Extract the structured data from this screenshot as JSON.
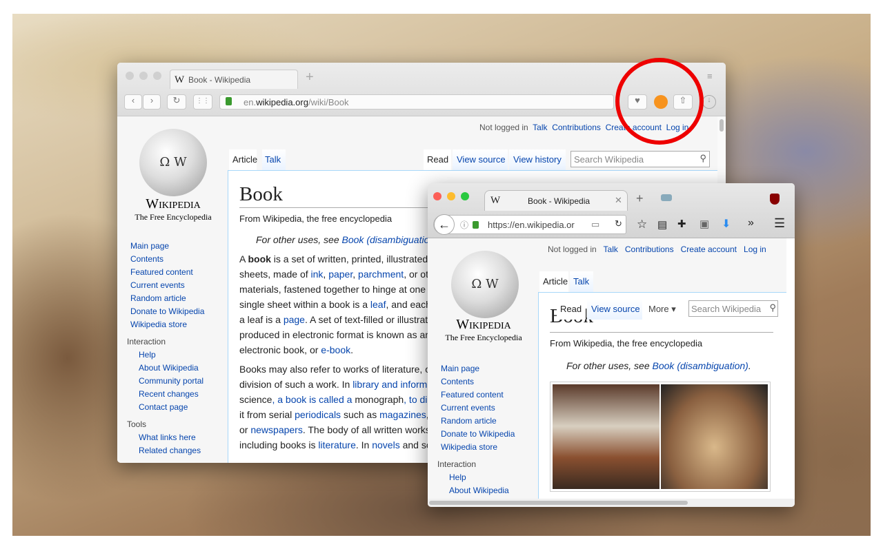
{
  "back": {
    "tab_title": "Book - Wikipedia",
    "url_prefix": "en.",
    "url_domain": "wikipedia.org",
    "url_path": "/wiki/Book",
    "personal": {
      "not_logged": "Not logged in",
      "talk": "Talk",
      "contributions": "Contributions",
      "create": "Create account",
      "login": "Log in"
    },
    "tabs": {
      "article": "Article",
      "talk": "Talk",
      "read": "Read",
      "view_source": "View source",
      "view_history": "View history"
    },
    "search_placeholder": "Search Wikipedia",
    "wordmark": "Wikipedia",
    "tagline": "The Free Encyclopedia",
    "title": "Book",
    "from": "From Wikipedia, the free encyclopedia",
    "hatnote_pre": "For other uses, see ",
    "hatnote_link": "Book (disambiguatio",
    "lines": [
      [
        "A ",
        "<b>book",
        "is a set of written, printed, illustrated"
      ],
      [
        "sheets, made of ",
        "ink",
        ", ",
        "paper",
        ", ",
        "parchment",
        ", or ot"
      ],
      [
        "materials, fastened together to hinge at one"
      ],
      [
        "single sheet within a book is a ",
        "leaf",
        ", and each"
      ],
      [
        "a leaf is a ",
        "page",
        ". A set of text-filled or illustrat"
      ],
      [
        "produced in electronic format is known as an"
      ],
      [
        "electronic book, or ",
        "e-book",
        "."
      ]
    ],
    "lines2": [
      [
        "Books may also refer to works of literature, o"
      ],
      [
        "division of such a work. In ",
        "library and inform"
      ],
      [
        "science",
        ", a book is called a ",
        "monograph",
        ", to di"
      ],
      [
        "it from serial ",
        "periodicals",
        " such as ",
        "magazines",
        ","
      ],
      [
        "or ",
        "newspapers",
        ". The body of all written works"
      ],
      [
        "including books is ",
        "literature",
        ". In ",
        "novels",
        " and so"
      ]
    ],
    "nav": [
      "Main page",
      "Contents",
      "Featured content",
      "Current events",
      "Random article",
      "Donate to Wikipedia",
      "Wikipedia store"
    ],
    "interaction_h": "Interaction",
    "interaction": [
      "Help",
      "About Wikipedia",
      "Community portal",
      "Recent changes",
      "Contact page"
    ],
    "tools_h": "Tools",
    "tools": [
      "What links here",
      "Related changes"
    ]
  },
  "front": {
    "tab_title": "Book - Wikipedia",
    "url": "https://en.wikipedia.or",
    "personal": {
      "not_logged": "Not logged in",
      "talk": "Talk",
      "contributions": "Contributions",
      "create": "Create account",
      "login": "Log in"
    },
    "tabs": {
      "article": "Article",
      "talk": "Talk",
      "read": "Read",
      "view_source": "View source",
      "more": "More"
    },
    "search_placeholder": "Search Wikipedia",
    "wordmark": "Wikipedia",
    "tagline": "The Free Encyclopedia",
    "title": "Book",
    "from": "From Wikipedia, the free encyclopedia",
    "hatnote_pre": "For other uses, see ",
    "hatnote_link": "Book (disambiguation)",
    "hatnote_end": ".",
    "nav": [
      "Main page",
      "Contents",
      "Featured content",
      "Current events",
      "Random article",
      "Donate to Wikipedia",
      "Wikipedia store"
    ],
    "interaction_h": "Interaction",
    "interaction": [
      "Help",
      "About Wikipedia"
    ]
  },
  "annotation": {
    "color": "#ee0000"
  }
}
